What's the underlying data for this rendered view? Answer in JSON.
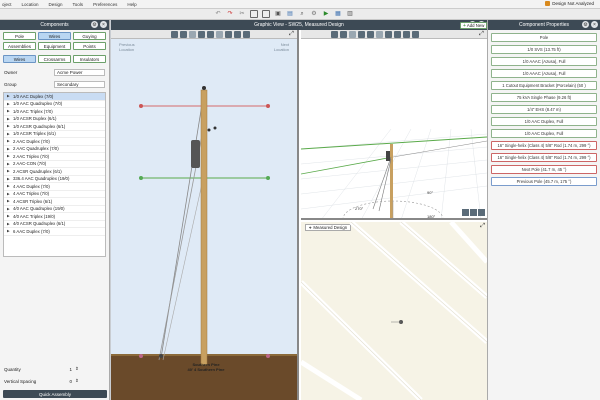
{
  "menu": [
    "oject",
    "Location",
    "Design",
    "Tools",
    "Preferences",
    "Help"
  ],
  "status": "Design Not Analyzed",
  "left_panel": {
    "title": "Components",
    "tabs_row1": [
      "Pole",
      "Wires",
      "Guying"
    ],
    "tabs_row2": [
      "Assemblies",
      "Equipment",
      "Points"
    ],
    "tabs_row3": [
      "Wires",
      "Crossarms",
      "Insulators"
    ],
    "owner_label": "Owner",
    "owner_value": "Acme Power",
    "group_label": "Group",
    "group_value": "Secondary",
    "items": [
      "1/0 AAC Duplex (7/0)",
      "1/0 AAC Quadruplex (7/0)",
      "1/0 AAC Triplex (7/0)",
      "1/0 ACSR Duplex (6/1)",
      "1/0 ACSR Quadruplex (6/1)",
      "1/0 ACSR Triplex (6/1)",
      "2 AAC Duplex (7/0)",
      "2 AAC Quadruplex (7/0)",
      "2 AAC Triplex (7/0)",
      "2 AAC-CON (7/0)",
      "2 ACSR Quadruplex (6/1)",
      "336.4 AAC Quadruplex (19/0)",
      "4 AAC Duplex (7/0)",
      "4 AAC Triplex (7/0)",
      "4 ACSR Triplex (6/1)",
      "4/0 AAC Quadruplex (19/0)",
      "4/0 AAC Triplex (19/0)",
      "4/0 ACSR Quadruplex (6/1)",
      "6 AAC Duplex (7/0)"
    ],
    "quantity_label": "Quantity",
    "quantity_value": "1",
    "spacing_label": "Vertical Spacing",
    "spacing_value": "0",
    "quick_assembly": "Quick Assembly"
  },
  "graphic_view": {
    "title": "Graphic View - SW25, Measured Design",
    "prev_location": "Previous\nLocation",
    "next_location": "Next\nLocation",
    "pole_label_1": "Southern Pine",
    "pole_label_2": "40' 4 Southern Pine",
    "angle_1": "270°",
    "angle_2": "180°",
    "angle_3": "90°",
    "map_title": "Measured Design"
  },
  "right_panel": {
    "title": "Component Properties",
    "add_new": "Add New",
    "items": [
      {
        "label": "Pole",
        "style": "green"
      },
      {
        "label": "1/0 SVS (13.75 ft)",
        "style": "green"
      },
      {
        "label": "1/0 AAAC (Azusa), Full",
        "style": "green"
      },
      {
        "label": "1/0 AAAC (Azusa), Full",
        "style": "green"
      },
      {
        "label": "1 Cutout Equipment Bracket (Porcelain) (50 )",
        "style": "green"
      },
      {
        "label": "75 kVA Single Phase (9.26 ft)",
        "style": "green"
      },
      {
        "label": "1/4\" EHS (8.47 m)",
        "style": "green"
      },
      {
        "label": "1/0 AAC Duplex, Full",
        "style": "green"
      },
      {
        "label": "1/0 AAC Duplex, Full",
        "style": "green"
      },
      {
        "label": "16\" Single-helix (Class 4) 5/8\" Rod (1.74 m, 299 °)",
        "style": "red"
      },
      {
        "label": "16\" Single-helix (Class 4) 5/8\" Rod (1.74 m, 299 °)",
        "style": "red"
      },
      {
        "label": "Next Pole (41.7 m, 45 °)",
        "style": "red"
      },
      {
        "label": "Previous Pole (45.7 m, 175 °)",
        "style": "blue"
      }
    ]
  },
  "colors": {
    "header": "#3d4a55",
    "sky": "#dfeaf6",
    "ground": "#6a4a2a",
    "pole": "#c8a060",
    "red_line": "#d46a6a",
    "green_line": "#5aaa4a"
  }
}
